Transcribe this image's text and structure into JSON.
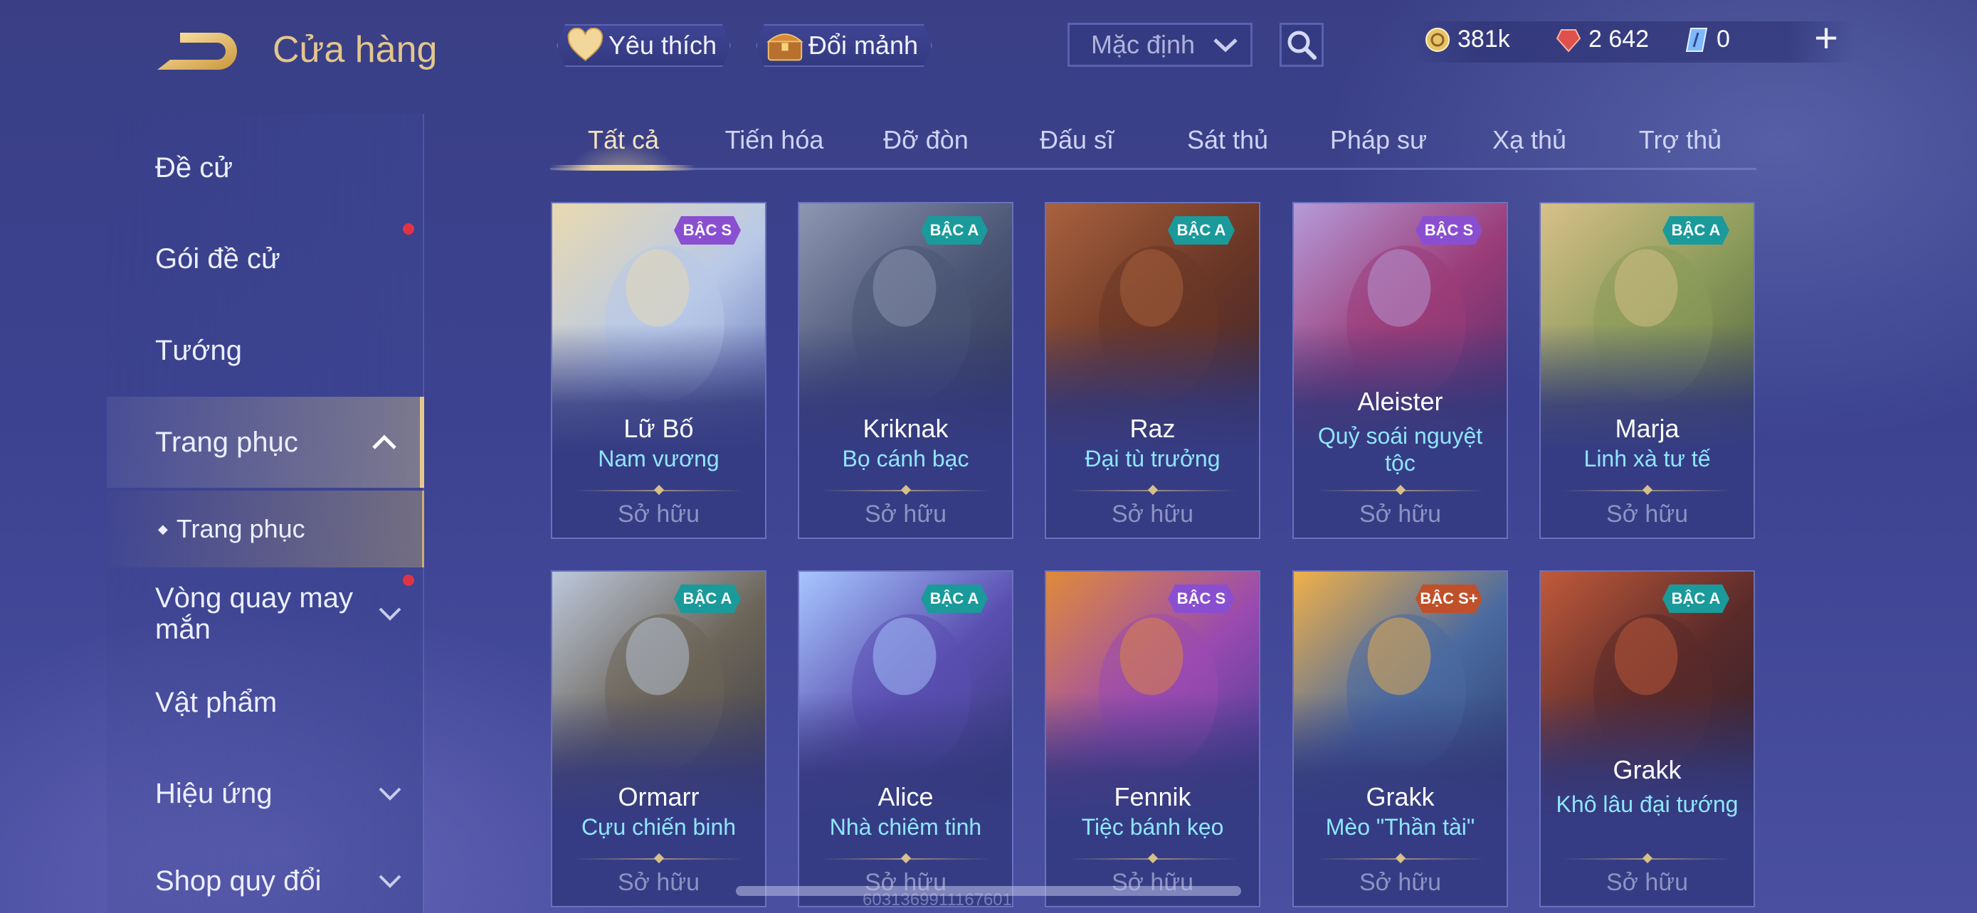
{
  "header": {
    "title": "Cửa hàng",
    "favorite_label": "Yêu thích",
    "shard_label": "Đổi mảnh",
    "sort_value": "Mặc định",
    "currencies": [
      {
        "icon": "gold-coin-icon",
        "value": "381k",
        "color": "#e7c36b"
      },
      {
        "icon": "red-gem-icon",
        "value": "2 642",
        "color": "#e0504c"
      },
      {
        "icon": "blue-ticket-icon",
        "value": "0",
        "color": "#7fb8ff"
      }
    ],
    "add_label": "+"
  },
  "sidebar": {
    "items": [
      {
        "label": "Đề cử"
      },
      {
        "label": "Gói đề cử"
      },
      {
        "label": "Tướng"
      },
      {
        "label": "Trang phục"
      },
      {
        "label": "Trang phục"
      },
      {
        "label": "Vòng quay may mắn"
      },
      {
        "label": "Vật phẩm"
      },
      {
        "label": "Hiệu ứng"
      },
      {
        "label": "Shop quy đổi"
      }
    ]
  },
  "tabs": [
    {
      "label": "Tất cả"
    },
    {
      "label": "Tiến hóa"
    },
    {
      "label": "Đỡ đòn"
    },
    {
      "label": "Đấu sĩ"
    },
    {
      "label": "Sát thủ"
    },
    {
      "label": "Pháp sư"
    },
    {
      "label": "Xạ thủ"
    },
    {
      "label": "Trợ thủ"
    }
  ],
  "cards": [
    {
      "hero": "Lữ Bố",
      "skin": "Nam vương",
      "status": "Sở hữu",
      "tier": "BẬC S",
      "tier_color": "#8a4fd0",
      "art": [
        "#e9d9b0",
        "#b8c9e8",
        "#5a6bb0"
      ]
    },
    {
      "hero": "Kriknak",
      "skin": "Bọ cánh bạc",
      "status": "Sở hữu",
      "tier": "BẬC A",
      "tier_color": "#1a9a9a",
      "art": [
        "#8d97b2",
        "#4b5574",
        "#2b3350"
      ]
    },
    {
      "hero": "Raz",
      "skin": "Đại tù trưởng",
      "status": "Sở hữu",
      "tier": "BẬC A",
      "tier_color": "#1a9a9a",
      "art": [
        "#a9623e",
        "#6a3626",
        "#3a2430"
      ]
    },
    {
      "hero": "Aleister",
      "skin": "Quỷ soái nguyệt tộc",
      "status": "Sở hữu",
      "tier": "BẬC S",
      "tier_color": "#8a4fd0",
      "art": [
        "#b59bd8",
        "#9a3c78",
        "#4a2d6a"
      ]
    },
    {
      "hero": "Marja",
      "skin": "Linh xà tư tế",
      "status": "Sở hữu",
      "tier": "BẬC A",
      "tier_color": "#1a9a9a",
      "art": [
        "#d8c08a",
        "#8a9a5a",
        "#4a5a3a"
      ]
    },
    {
      "hero": "Ormarr",
      "skin": "Cựu chiến binh",
      "status": "Sở hữu",
      "tier": "BẬC A",
      "tier_color": "#1a9a9a",
      "art": [
        "#bcc8dc",
        "#6b6458",
        "#3a3a46"
      ]
    },
    {
      "hero": "Alice",
      "skin": "Nhà chiêm tinh",
      "status": "Sở hữu",
      "tier": "BẬC A",
      "tier_color": "#1a9a9a",
      "art": [
        "#a7c6ff",
        "#5a4fb0",
        "#2e3470"
      ]
    },
    {
      "hero": "Fennik",
      "skin": "Tiệc bánh kẹo",
      "status": "Sở hữu",
      "tier": "BẬC S",
      "tier_color": "#8a4fd0",
      "art": [
        "#e08a3a",
        "#9a4ab0",
        "#3a3a90"
      ]
    },
    {
      "hero": "Grakk",
      "skin": "Mèo \"Thần tài\"",
      "status": "Sở hữu",
      "tier": "BẬC S+",
      "tier_color": "#c0502a",
      "art": [
        "#f0b04a",
        "#4a6aa0",
        "#2a3a6a"
      ]
    },
    {
      "hero": "Grakk",
      "skin": "Khô lâu đại tướng",
      "status": "Sở hữu",
      "tier": "BẬC A",
      "tier_color": "#1a9a9a",
      "art": [
        "#c05a3a",
        "#5a2a2a",
        "#2a2030"
      ]
    }
  ],
  "footer": {
    "watermark": "6031369911167601"
  }
}
